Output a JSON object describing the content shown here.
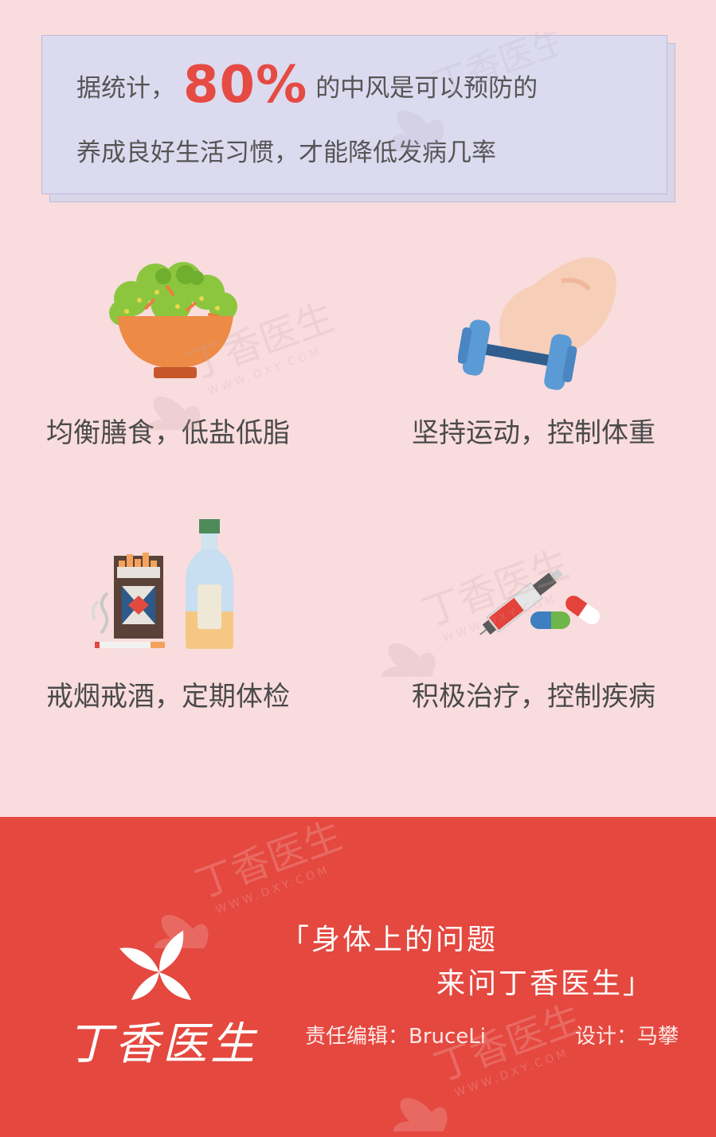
{
  "card": {
    "prefix": "据统计，",
    "percent": "80%",
    "suffix": "的中风是可以预防的",
    "line2": "养成良好生活习惯，才能降低发病几率"
  },
  "tips": [
    {
      "label": "均衡膳食，低盐低脂",
      "icon": "salad-bowl-icon"
    },
    {
      "label": "坚持运动，控制体重",
      "icon": "dumbbell-arm-icon"
    },
    {
      "label": "戒烟戒酒，定期体检",
      "icon": "cigarette-bottle-icon"
    },
    {
      "label": "积极治疗，控制疾病",
      "icon": "syringe-pill-icon"
    }
  ],
  "watermark": {
    "text": "丁香医生",
    "url": "WWW.DXY.COM"
  },
  "footer": {
    "logo_text": "丁香医生",
    "slogan_line1": "「身体上的问题",
    "slogan_line2": "来问丁香医生」",
    "editor": "责任编辑：BruceLi",
    "designer": "设计：马攀"
  },
  "colors": {
    "background": "#f9dcde",
    "card": "#dcdaef",
    "accent_red": "#e54b43",
    "footer": "#e4483f"
  }
}
